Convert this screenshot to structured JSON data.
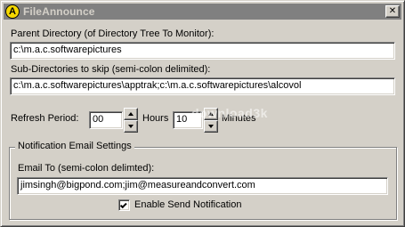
{
  "window": {
    "title": "FileAnnounce",
    "icon_letter": "A",
    "close_glyph": "✕"
  },
  "parent_directory": {
    "label": "Parent Directory (of Directory Tree To Monitor):",
    "value": "c:\\m.a.c.softwarepictures"
  },
  "subdirectories": {
    "label": "Sub-Directories to skip (semi-colon delimited):",
    "value": "c:\\m.a.c.softwarepictures\\apptrak;c:\\m.a.c.softwarepictures\\alcovol"
  },
  "refresh": {
    "label": "Refresh Period:",
    "hours_value": "00",
    "hours_label": "Hours",
    "minutes_value": "10",
    "minutes_label": "Minutes"
  },
  "notification": {
    "group_title": "Notification Email Settings",
    "email_label": "Email To (semi-colon delimted):",
    "email_value": "jimsingh@bigpond.com;jim@measureandconvert.com",
    "enable_label": "Enable Send Notification",
    "enable_checked": true
  },
  "watermark": "download3k",
  "icons": {
    "app": "app-a-icon",
    "close": "close-icon",
    "spin_up": "arrow-up-icon",
    "spin_down": "arrow-down-icon",
    "check": "checkmark-icon"
  },
  "colors": {
    "titlebar_bg": "#808080",
    "titlebar_text": "#d4d0c8",
    "dialog_bg": "#d4d0c8",
    "app_icon_bg": "#f5d800"
  }
}
